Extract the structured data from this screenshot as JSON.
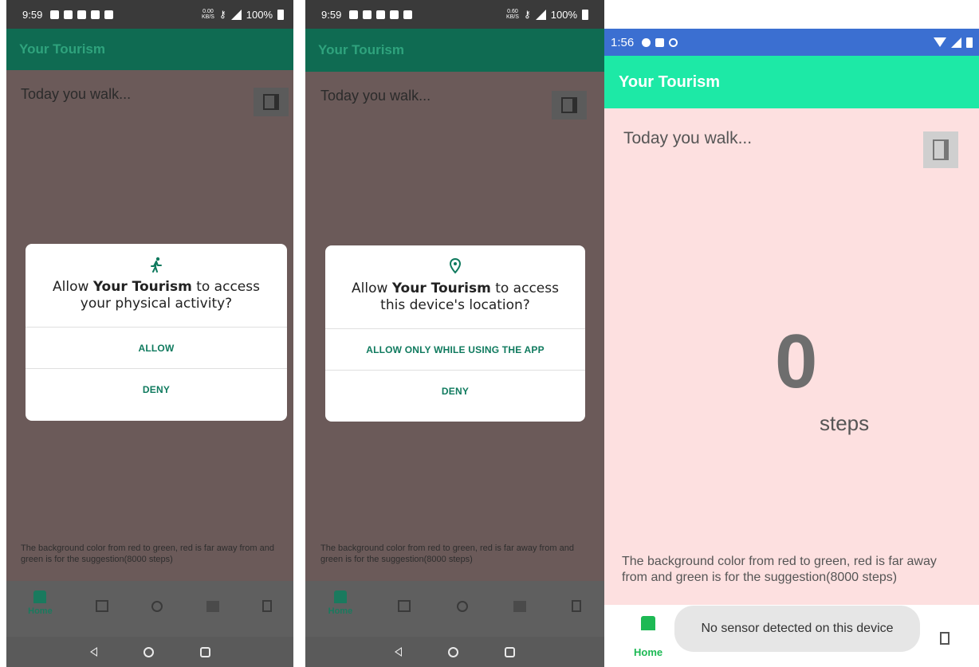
{
  "colors": {
    "appbar_dimmed": "#0f6b52",
    "statusbar_dimmed": "#3a3a3a",
    "content_dimmed": "#6b5a59",
    "nav_dimmed": "#5f5f5f",
    "appbar_active": "#1de9a6",
    "statusbar_active": "#3b6fd1",
    "content_active": "#fde0e0",
    "accent": "#0f7a5e",
    "home_green": "#1db954"
  },
  "screens": [
    {
      "status": {
        "time": "9:59",
        "net_speed": "0.00\nKB/S",
        "battery": "100%"
      },
      "app_title": "Your Tourism",
      "prompt": "Today you walk...",
      "footnote": "The background color from red to green, red is far away from and green is for the suggestion(8000 steps)",
      "nav_home_label": "Home",
      "dialog": {
        "icon": "running-icon",
        "title_prefix": "Allow ",
        "title_app": "Your Tourism",
        "title_suffix": " to access your physical activity?",
        "buttons": [
          "ALLOW",
          "DENY"
        ]
      }
    },
    {
      "status": {
        "time": "9:59",
        "net_speed": "0.60\nKB/S",
        "battery": "100%"
      },
      "app_title": "Your Tourism",
      "prompt": "Today you walk...",
      "footnote": "The background color from red to green, red is far away from and green is for the suggestion(8000 steps)",
      "nav_home_label": "Home",
      "dialog": {
        "icon": "location-pin-icon",
        "title_prefix": "Allow ",
        "title_app": "Your Tourism",
        "title_suffix": " to access this device's location?",
        "buttons": [
          "ALLOW ONLY WHILE USING THE APP",
          "DENY"
        ]
      }
    },
    {
      "status": {
        "time": "1:56"
      },
      "app_title": "Your Tourism",
      "prompt": "Today you walk...",
      "steps_value": "0",
      "steps_unit": "steps",
      "footnote": "The background color from red to green, red is far away from and green is for the suggestion(8000 steps)",
      "nav_home_label": "Home",
      "toast": "No sensor detected on this device"
    }
  ],
  "bottom_nav_icons": [
    "home-icon",
    "map-icon",
    "add-circle-icon",
    "photo-icon",
    "battery-icon"
  ]
}
